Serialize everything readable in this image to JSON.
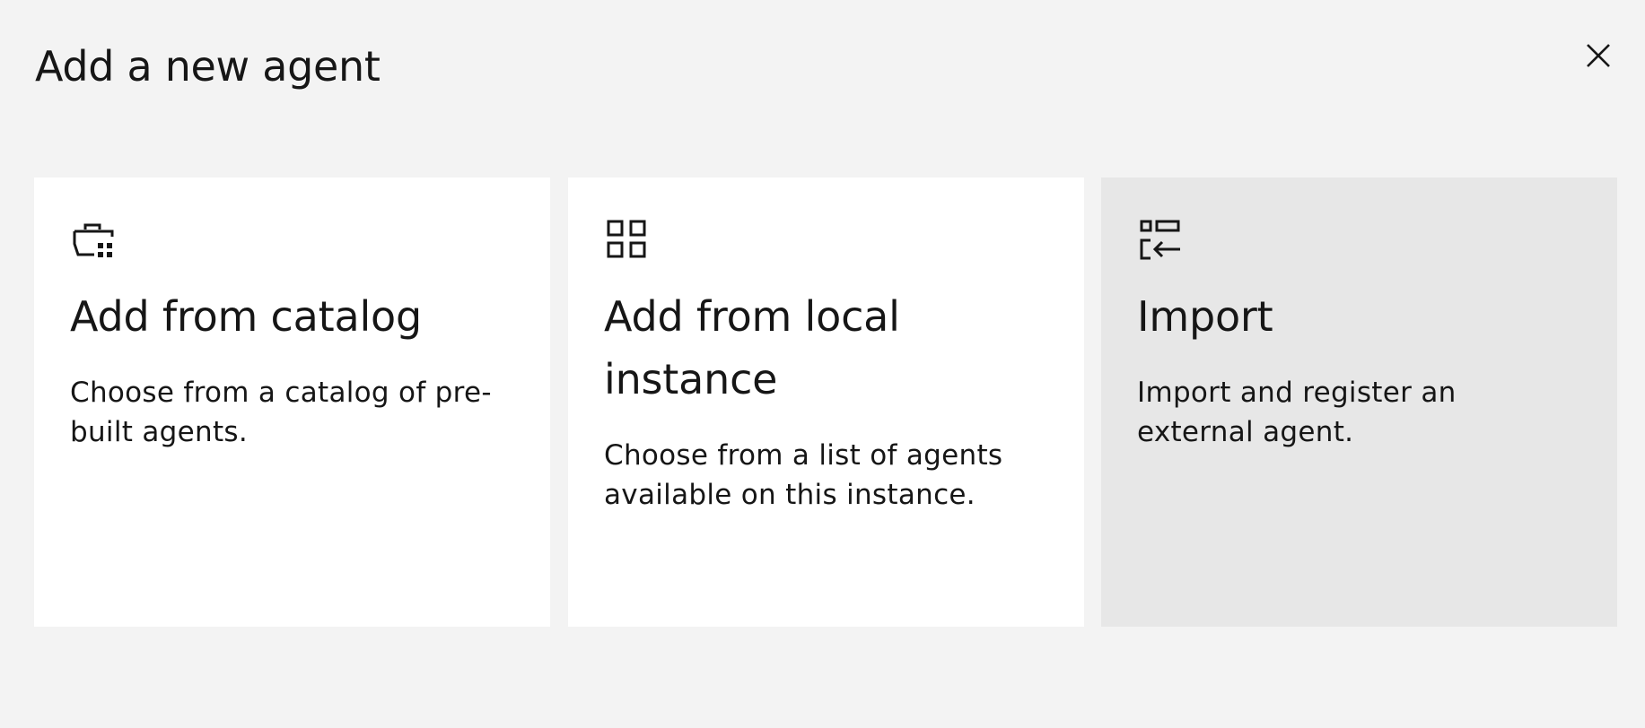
{
  "modal": {
    "title": "Add a new agent",
    "close_icon": "close-icon"
  },
  "options": [
    {
      "icon": "catalog-icon",
      "title": "Add from catalog",
      "description": "Choose from a catalog of pre-built agents."
    },
    {
      "icon": "grid-icon",
      "title": "Add from local instance",
      "description": "Choose from a list of agents available on this instance."
    },
    {
      "icon": "import-icon",
      "title": "Import",
      "description": "Import and register an external agent."
    }
  ],
  "colors": {
    "background": "#f3f3f3",
    "card": "#ffffff",
    "card_active": "#e7e7e7",
    "text": "#161616"
  }
}
